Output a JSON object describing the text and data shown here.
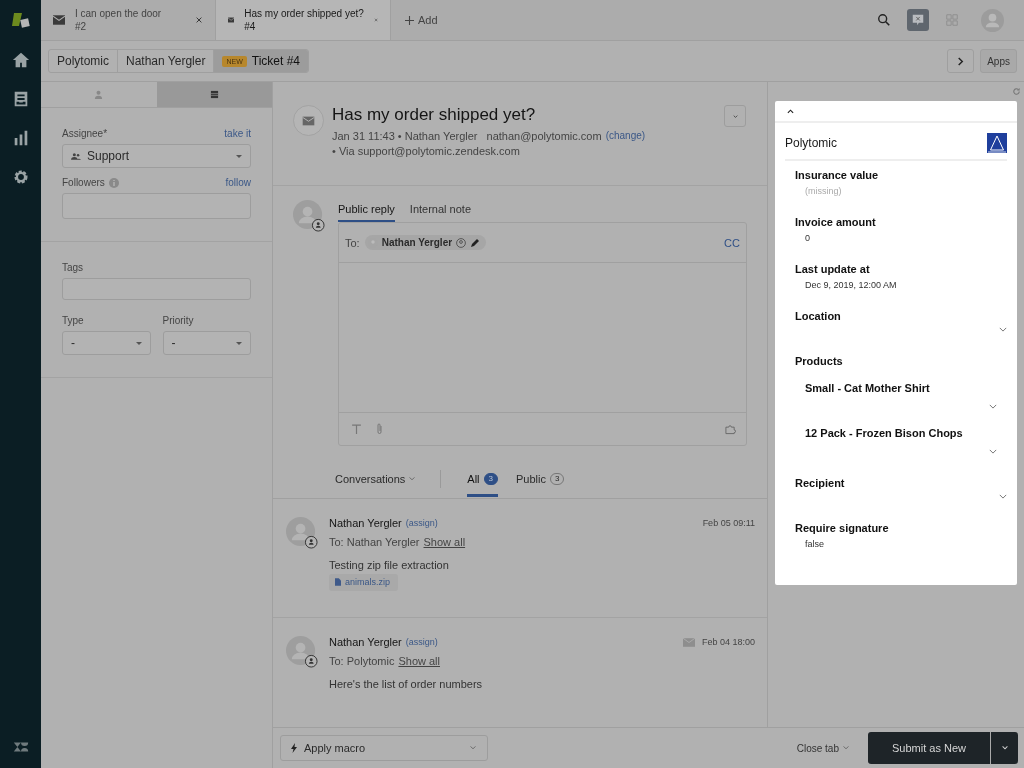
{
  "nav": [
    {
      "kind": "home"
    },
    {
      "kind": "views"
    },
    {
      "kind": "reporting"
    },
    {
      "kind": "admin"
    }
  ],
  "top_tabs": [
    {
      "title": "I can open the door",
      "number": "#2",
      "selected": false
    },
    {
      "title": "Has my order shipped yet?",
      "number": "#4",
      "selected": true
    }
  ],
  "add_tab": "Add",
  "toolbar": [
    {
      "kind": "search",
      "selected": false
    },
    {
      "kind": "chat",
      "selected": true
    },
    {
      "kind": "apps",
      "selected": false
    }
  ],
  "breadcrumbs": [
    {
      "label": "Polytomic",
      "selected": false
    },
    {
      "label": "Nathan Yergler",
      "selected": false
    },
    {
      "label": "Ticket #4",
      "badge": "NEW",
      "selected": true
    }
  ],
  "apps_button": "Apps",
  "properties_tabs": [
    {
      "kind": "user",
      "selected": false
    },
    {
      "kind": "ticket",
      "selected": true
    }
  ],
  "assignee": {
    "label": "Assignee*",
    "action": "take it",
    "value": "Support"
  },
  "followers": {
    "label": "Followers",
    "action": "follow"
  },
  "tags": {
    "label": "Tags"
  },
  "type": {
    "label": "Type",
    "value": "-"
  },
  "priority": {
    "label": "Priority",
    "value": "-"
  },
  "ticket": {
    "title": "Has my order shipped yet?",
    "meta": "Jan 31 11:43 • Nathan Yergler",
    "email": "nathan@polytomic.com",
    "change": "(change)",
    "via": "• Via support@polytomic.zendesk.com"
  },
  "composer": {
    "tabs": [
      {
        "label": "Public reply",
        "selected": true
      },
      {
        "label": "Internal note",
        "selected": false
      }
    ],
    "to_label": "To:",
    "recipient": "Nathan Yergler",
    "cc": "CC"
  },
  "conversation_filter": {
    "menu": "Conversations",
    "tabs": [
      {
        "label": "All",
        "count": "3",
        "selected": true
      },
      {
        "label": "Public",
        "count": "3",
        "selected": false
      }
    ]
  },
  "messages": [
    {
      "author": "Nathan Yergler",
      "assign": "(assign)",
      "to": "To: Nathan Yergler",
      "show_all": "Show all",
      "time": "Feb 05 09:11",
      "via_email": false,
      "body": "Testing zip file extraction",
      "attachment": "animals.zip"
    },
    {
      "author": "Nathan Yergler",
      "assign": "(assign)",
      "to": "To: Polytomic",
      "show_all": "Show all",
      "time": "Feb 04 18:00",
      "via_email": true,
      "body": "Here's the list of order numbers"
    }
  ],
  "app": {
    "name": "Polytomic",
    "fields": [
      {
        "kind": "value",
        "label": "Insurance value",
        "value": "(missing)",
        "muted": true
      },
      {
        "kind": "value",
        "label": "Invoice amount",
        "value": "0",
        "muted": false
      },
      {
        "kind": "value",
        "label": "Last update at",
        "value": "Dec 9, 2019, 12:00 AM",
        "muted": false
      },
      {
        "kind": "dropdown",
        "label": "Location"
      },
      {
        "kind": "group",
        "label": "Products",
        "children": [
          {
            "label": "Small - Cat Mother Shirt"
          },
          {
            "label": "12 Pack - Frozen Bison Chops"
          }
        ]
      },
      {
        "kind": "dropdown",
        "label": "Recipient"
      },
      {
        "kind": "value",
        "label": "Require signature",
        "value": "false",
        "muted": false
      }
    ]
  },
  "footer": {
    "macro": "Apply macro",
    "close_tab": "Close tab",
    "submit": "Submit as New"
  }
}
